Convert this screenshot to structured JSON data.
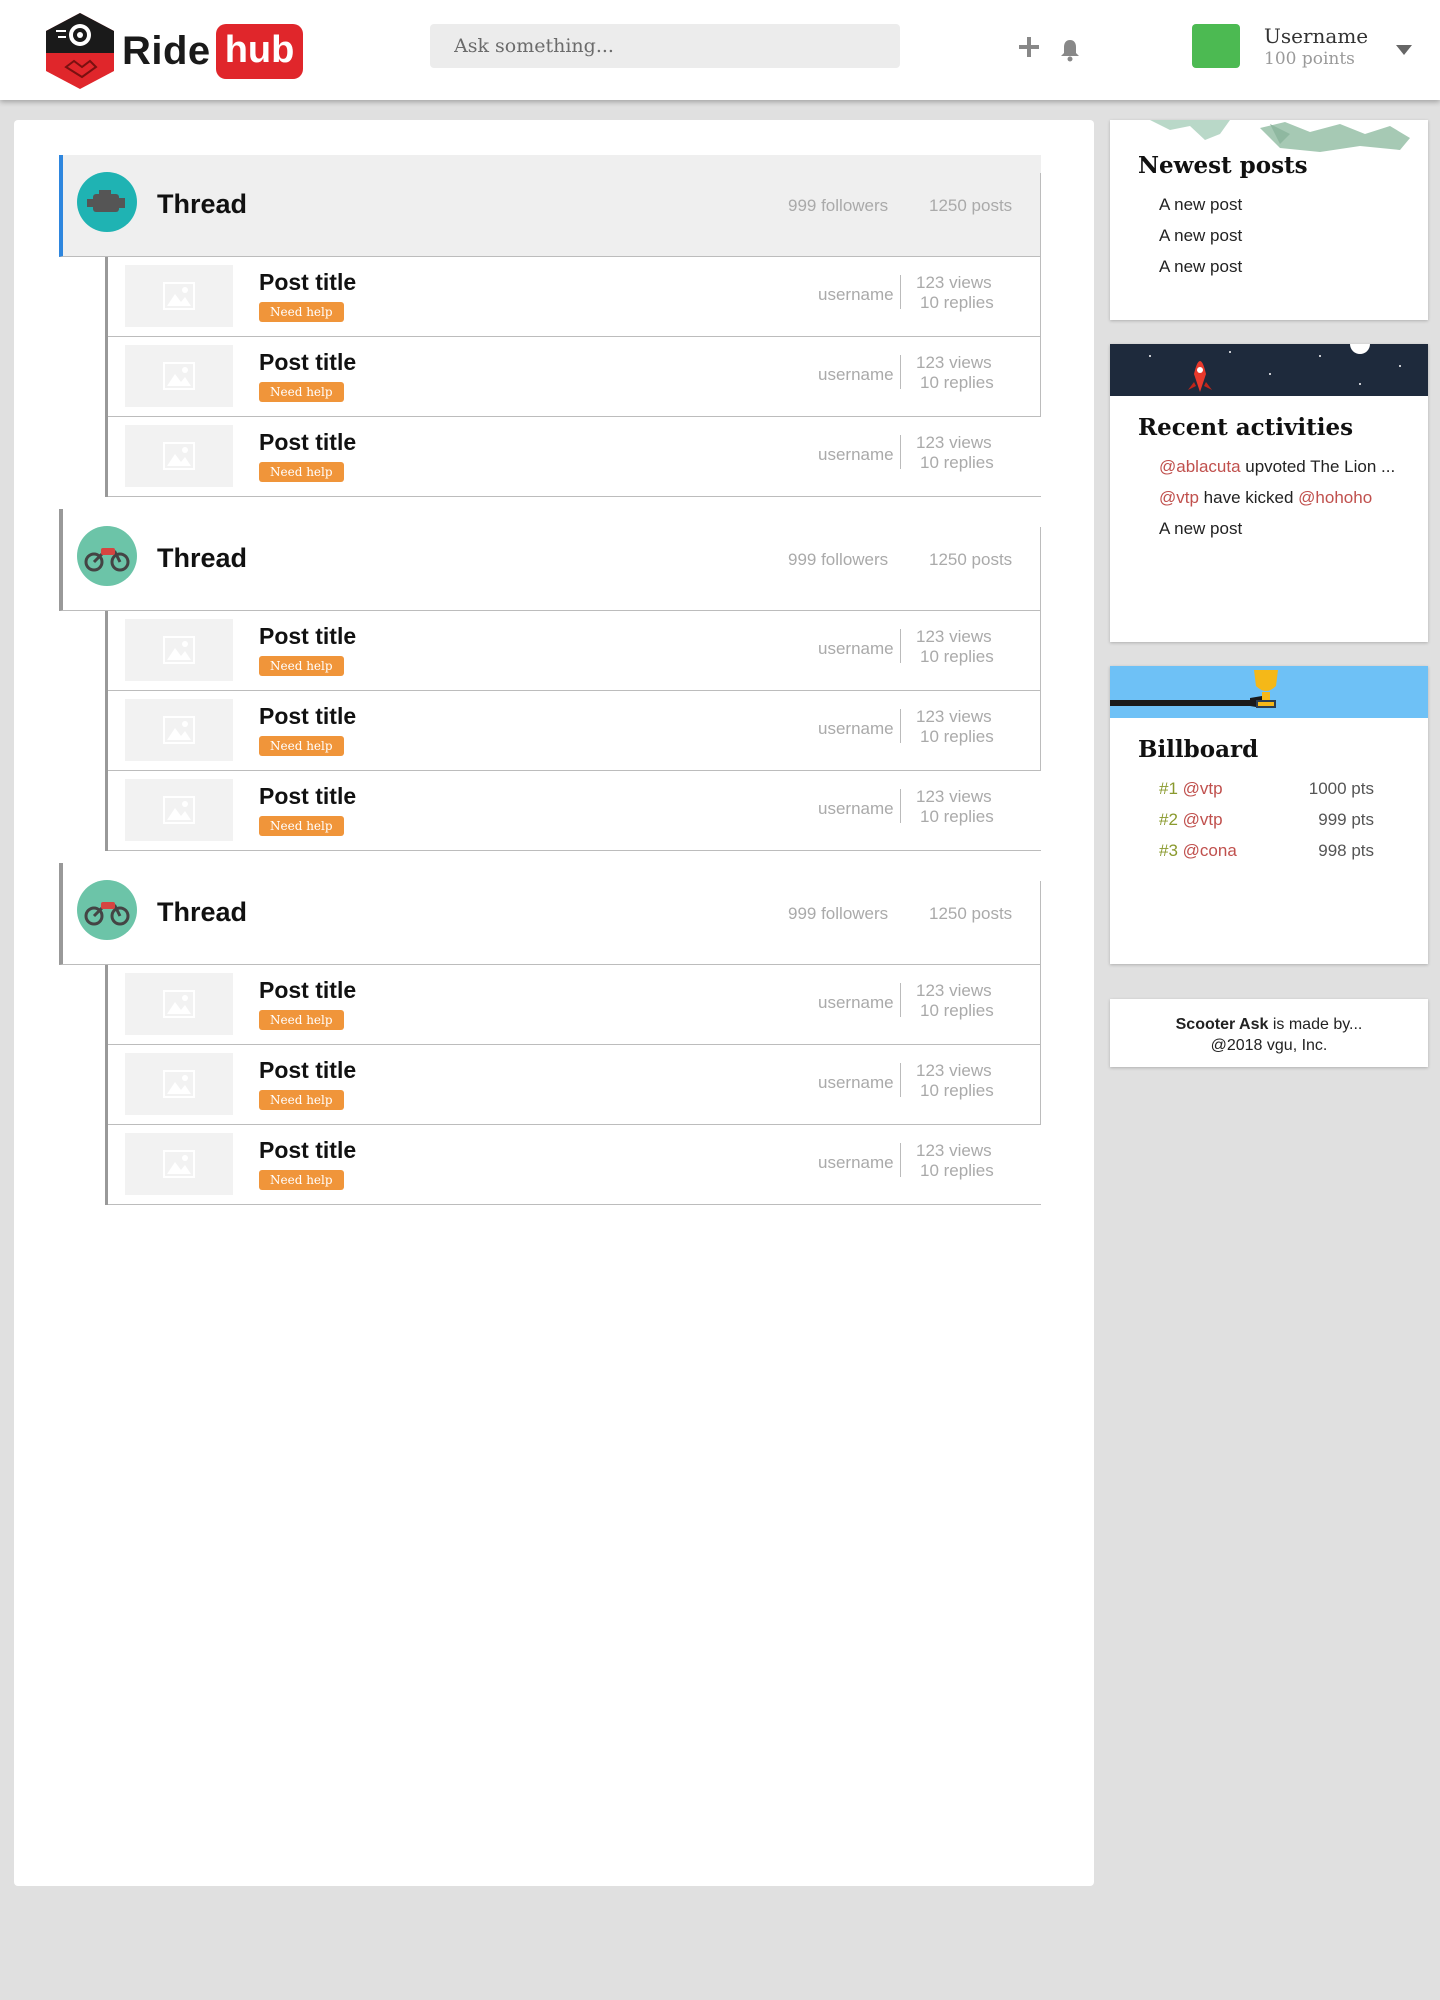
{
  "header": {
    "logo_ride": "Ride",
    "logo_hub": "hub",
    "search_placeholder": "Ask something...",
    "username": "Username",
    "points": "100 points",
    "avatar_color": "#4cba52"
  },
  "threads": [
    {
      "title": "Thread",
      "followers": "999 followers",
      "posts_count": "1250 posts",
      "icon": "engine-icon",
      "active": true,
      "posts": [
        {
          "title": "Post title",
          "badge": "Need help",
          "user": "username",
          "views": "123 views",
          "replies": "10 replies"
        },
        {
          "title": "Post title",
          "badge": "Need help",
          "user": "username",
          "views": "123 views",
          "replies": "10 replies"
        },
        {
          "title": "Post title",
          "badge": "Need help",
          "user": "username",
          "views": "123 views",
          "replies": "10 replies"
        }
      ]
    },
    {
      "title": "Thread",
      "followers": "999 followers",
      "posts_count": "1250 posts",
      "icon": "motorbike-icon",
      "active": false,
      "posts": [
        {
          "title": "Post title",
          "badge": "Need help",
          "user": "username",
          "views": "123 views",
          "replies": "10 replies"
        },
        {
          "title": "Post title",
          "badge": "Need help",
          "user": "username",
          "views": "123 views",
          "replies": "10 replies"
        },
        {
          "title": "Post title",
          "badge": "Need help",
          "user": "username",
          "views": "123 views",
          "replies": "10 replies"
        }
      ]
    },
    {
      "title": "Thread",
      "followers": "999 followers",
      "posts_count": "1250 posts",
      "icon": "motorbike-icon",
      "active": false,
      "posts": [
        {
          "title": "Post title",
          "badge": "Need help",
          "user": "username",
          "views": "123 views",
          "replies": "10 replies"
        },
        {
          "title": "Post title",
          "badge": "Need help",
          "user": "username",
          "views": "123 views",
          "replies": "10 replies"
        },
        {
          "title": "Post title",
          "badge": "Need help",
          "user": "username",
          "views": "123 views",
          "replies": "10 replies"
        }
      ]
    }
  ],
  "sidebar": {
    "newest": {
      "title": "Newest posts",
      "items": [
        "A new post",
        "A new post",
        "A new post"
      ]
    },
    "recent": {
      "title": "Recent activities",
      "items": [
        {
          "mention": "@ablacuta",
          "text": " upvoted The Lion ...",
          "mention2": ""
        },
        {
          "mention": "@vtp",
          "text": " have kicked ",
          "mention2": "@hohoho"
        },
        {
          "mention": "",
          "text": "A new post",
          "mention2": ""
        }
      ]
    },
    "billboard": {
      "title": "Billboard",
      "items": [
        {
          "rank": "#1",
          "user": "@vtp",
          "pts": "1000 pts"
        },
        {
          "rank": "#2",
          "user": "@vtp",
          "pts": "999 pts"
        },
        {
          "rank": "#3",
          "user": "@cona",
          "pts": "998 pts"
        }
      ]
    },
    "footer": {
      "brand": "Scooter Ask",
      "made_by": " is made by...",
      "copyright": "@2018 vgu, Inc."
    }
  },
  "colors": {
    "brand_red": "#e0262b",
    "active_thread_accent": "#2e86de",
    "badge_orange": "#f0953a",
    "mention_red": "#c0504d",
    "rank_olive": "#8a9a2e"
  }
}
